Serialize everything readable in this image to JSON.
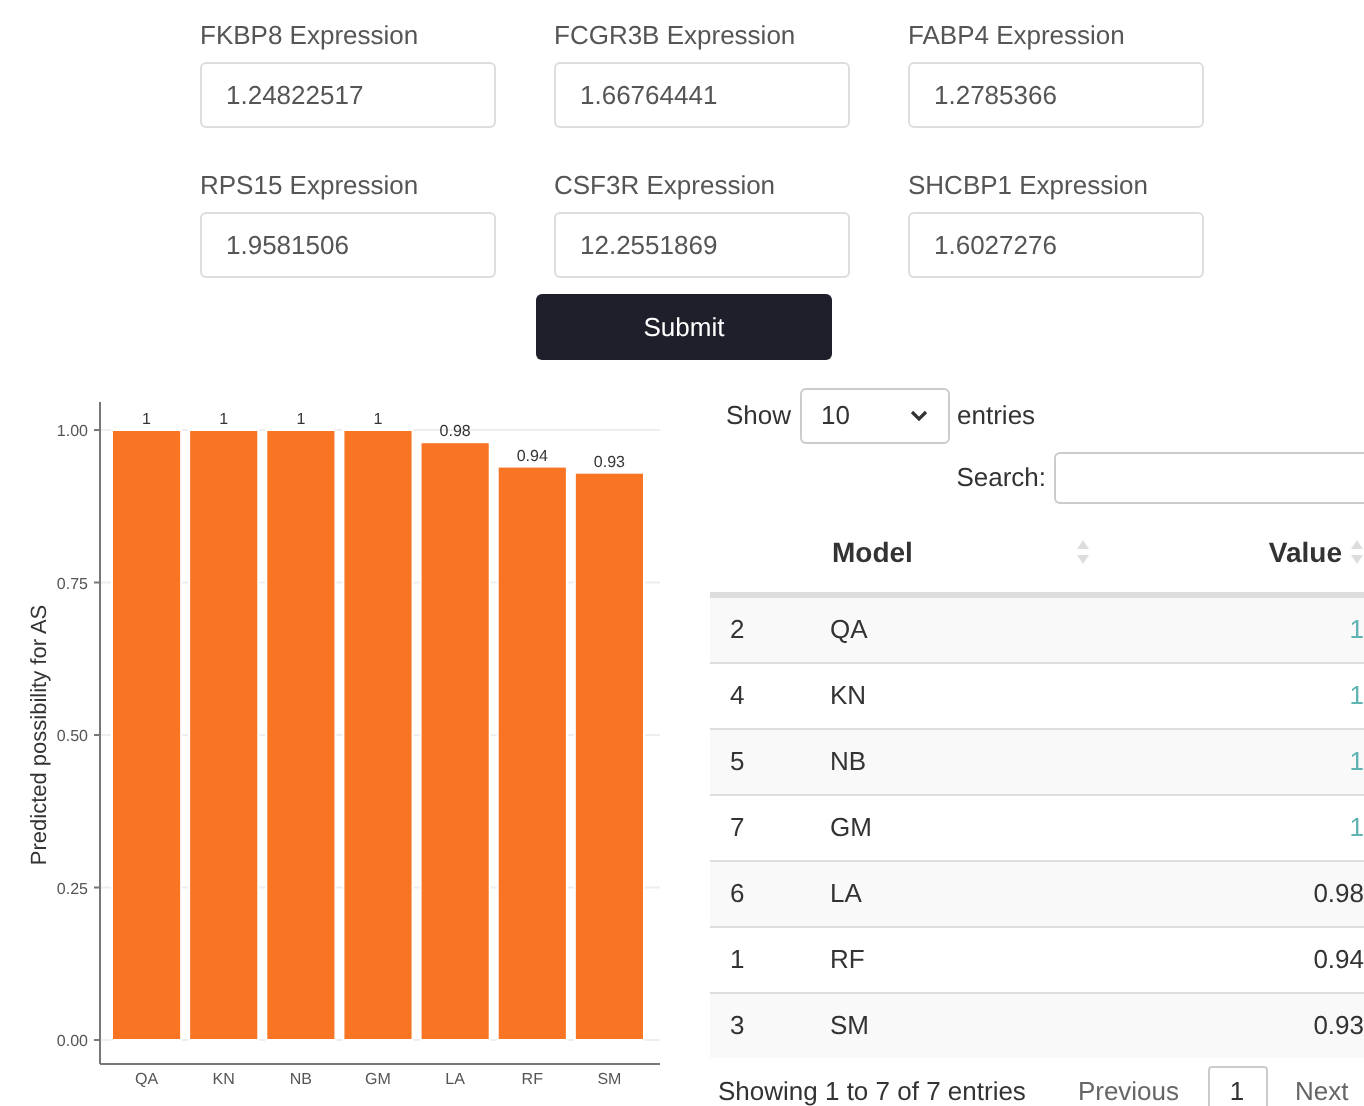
{
  "inputs": [
    {
      "label": "FKBP8 Expression",
      "value": "1.24822517"
    },
    {
      "label": "FCGR3B Expression",
      "value": "1.66764441"
    },
    {
      "label": "FABP4 Expression",
      "value": "1.2785366"
    },
    {
      "label": "RPS15 Expression",
      "value": "1.9581506"
    },
    {
      "label": "CSF3R Expression",
      "value": "12.2551869"
    },
    {
      "label": "SHCBP1 Expression",
      "value": "1.6027276"
    }
  ],
  "submit": "Submit",
  "chart": {
    "chart_data": {
      "type": "bar",
      "ylabel": "Predicted possibility for AS",
      "categories": [
        "QA",
        "KN",
        "NB",
        "GM",
        "LA",
        "RF",
        "SM"
      ],
      "grid": true,
      "series": [
        {
          "color": "#f97423",
          "values": [
            1,
            1,
            1,
            1,
            0.98,
            0.94,
            0.93
          ]
        }
      ],
      "ylim": [
        0,
        1
      ],
      "yticks": [
        {
          "value": 0,
          "label": "0.00"
        },
        {
          "value": 0.25,
          "label": "0.25"
        },
        {
          "value": 0.5,
          "label": "0.50"
        },
        {
          "value": 0.75,
          "label": "0.75"
        },
        {
          "value": 1,
          "label": "1.00"
        }
      ],
      "data_labels": true,
      "value_labels": [
        "1",
        "1",
        "1",
        "1",
        "0.98",
        "0.94",
        "0.93"
      ]
    }
  },
  "table": {
    "show_label": "Show",
    "page_size": "10",
    "entries_label": "entries",
    "search_label": "Search:",
    "columns": [
      "Model",
      "Value"
    ],
    "rows": [
      {
        "index": "2",
        "model": "QA",
        "value": "1",
        "highlight": true
      },
      {
        "index": "4",
        "model": "KN",
        "value": "1",
        "highlight": true
      },
      {
        "index": "5",
        "model": "NB",
        "value": "1",
        "highlight": true
      },
      {
        "index": "7",
        "model": "GM",
        "value": "1",
        "highlight": true
      },
      {
        "index": "6",
        "model": "LA",
        "value": "0.98",
        "highlight": false
      },
      {
        "index": "1",
        "model": "RF",
        "value": "0.94",
        "highlight": false
      },
      {
        "index": "3",
        "model": "SM",
        "value": "0.93",
        "highlight": false
      }
    ],
    "info": "Showing 1 to 7 of 7 entries",
    "previous": "Previous",
    "page": "1",
    "next": "Next"
  }
}
